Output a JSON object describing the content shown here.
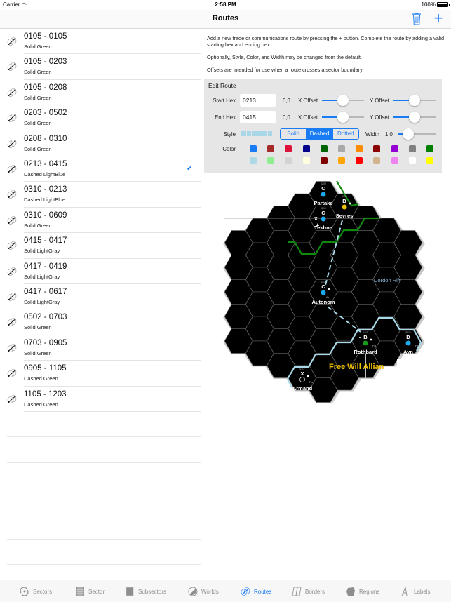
{
  "status_bar": {
    "carrier": "Carrier",
    "time": "2:58 PM",
    "battery": "100%"
  },
  "nav": {
    "title": "Routes",
    "trash_icon": "trash-icon",
    "add_label": "+"
  },
  "routes": [
    {
      "title": "0105 - 0105",
      "subtitle": "Solid Green",
      "selected": false
    },
    {
      "title": "0105 - 0203",
      "subtitle": "Solid Green",
      "selected": false
    },
    {
      "title": "0105 - 0208",
      "subtitle": "Solid Green",
      "selected": false
    },
    {
      "title": "0203 - 0502",
      "subtitle": "Solid Green",
      "selected": false
    },
    {
      "title": "0208 - 0310",
      "subtitle": "Solid Green",
      "selected": false
    },
    {
      "title": "0213 - 0415",
      "subtitle": "Dashed LightBlue",
      "selected": true
    },
    {
      "title": "0310 - 0213",
      "subtitle": "Dashed LightBlue",
      "selected": false
    },
    {
      "title": "0310 - 0609",
      "subtitle": "Solid Green",
      "selected": false
    },
    {
      "title": "0415 - 0417",
      "subtitle": "Solid LightGray",
      "selected": false
    },
    {
      "title": "0417 - 0419",
      "subtitle": "Solid LightGray",
      "selected": false
    },
    {
      "title": "0417 - 0617",
      "subtitle": "Solid LightGray",
      "selected": false
    },
    {
      "title": "0502 - 0703",
      "subtitle": "Solid Green",
      "selected": false
    },
    {
      "title": "0703 - 0905",
      "subtitle": "Solid Green",
      "selected": false
    },
    {
      "title": "0905 - 1105",
      "subtitle": "Dashed Green",
      "selected": false
    },
    {
      "title": "1105 - 1203",
      "subtitle": "Dashed Green",
      "selected": false
    }
  ],
  "help": {
    "p1": "Add a new trade or communications route by pressing the + button. Complete the route by adding a valid starting hex and ending hex.",
    "p2": "Optionally, Style, Color, and Width may be changed from the default.",
    "p3": "Offsets are intended for use when a route crosses a sector boundary."
  },
  "edit_route": {
    "title": "Edit Route",
    "start_hex_label": "Start Hex",
    "start_hex_value": "0213",
    "start_offset": "0,0",
    "end_hex_label": "End Hex",
    "end_hex_value": "0415",
    "end_offset": "0,0",
    "x_offset_label": "X Offset",
    "y_offset_label": "Y Offset",
    "start_x_offset_fraction": 0.5,
    "start_y_offset_fraction": 0.5,
    "end_x_offset_fraction": 0.5,
    "end_y_offset_fraction": 0.5,
    "style_label": "Style",
    "style_options": [
      "Solid",
      "Dashed",
      "Dotted"
    ],
    "style_selected": "Dashed",
    "width_label": "Width",
    "width_value": "1.0",
    "width_fraction": 0.15,
    "color_label": "Color",
    "colors_row1": [
      "#1a7cf5",
      "#a52a2a",
      "#dc143c",
      "#00008b",
      "#006400",
      "#a9a9a9",
      "#ff8c00",
      "#8b0000",
      "#9400d3",
      "#808080",
      "#008000"
    ],
    "colors_row2": [
      "#add8e6",
      "#90ee90",
      "#d3d3d3",
      "#ffffe0",
      "#800000",
      "#ffa500",
      "#ff0000",
      "#d2b48c",
      "#ee82ee",
      "#ffffff",
      "#ffff00"
    ]
  },
  "map": {
    "region_labels": [
      {
        "text": "Cordon Rift",
        "color": "#8fbce0"
      },
      {
        "text": "Free Will Allian",
        "color": "#f0c000"
      }
    ],
    "worlds": [
      {
        "name": "Partake",
        "starport": "C",
        "hex": "0209",
        "dot": "#1aaaf0"
      },
      {
        "name": "Sevres",
        "starport": "B",
        "hex": "0310",
        "dot": "#f0c000"
      },
      {
        "name": "Tekhne",
        "starport": "C",
        "hex": "0210",
        "dot": "#1aaaf0"
      },
      {
        "name": "Autonom",
        "starport": "C",
        "hex": "0213",
        "dot": "#1aaaf0"
      },
      {
        "name": "Rothbard",
        "starport": "B",
        "hex": "0415",
        "dot": "#1a9a1a"
      },
      {
        "name": "Ayn",
        "starport": "D",
        "hex": "0615",
        "dot": "#1aaaf0"
      },
      {
        "name": "Armand",
        "starport": "X",
        "hex": "0117",
        "dot": "none"
      }
    ],
    "codes": {
      "fw": "Fw"
    }
  },
  "tabs": [
    {
      "label": "Sectors",
      "icon": "galaxy-icon",
      "active": false
    },
    {
      "label": "Sector",
      "icon": "grid-icon",
      "active": false
    },
    {
      "label": "Subsectors",
      "icon": "square-icon",
      "active": false
    },
    {
      "label": "Worlds",
      "icon": "planet-icon",
      "active": false
    },
    {
      "label": "Routes",
      "icon": "routes-icon",
      "active": true
    },
    {
      "label": "Borders",
      "icon": "borders-icon",
      "active": false
    },
    {
      "label": "Regions",
      "icon": "regions-icon",
      "active": false
    },
    {
      "label": "Labels",
      "icon": "labels-icon",
      "active": false
    }
  ]
}
